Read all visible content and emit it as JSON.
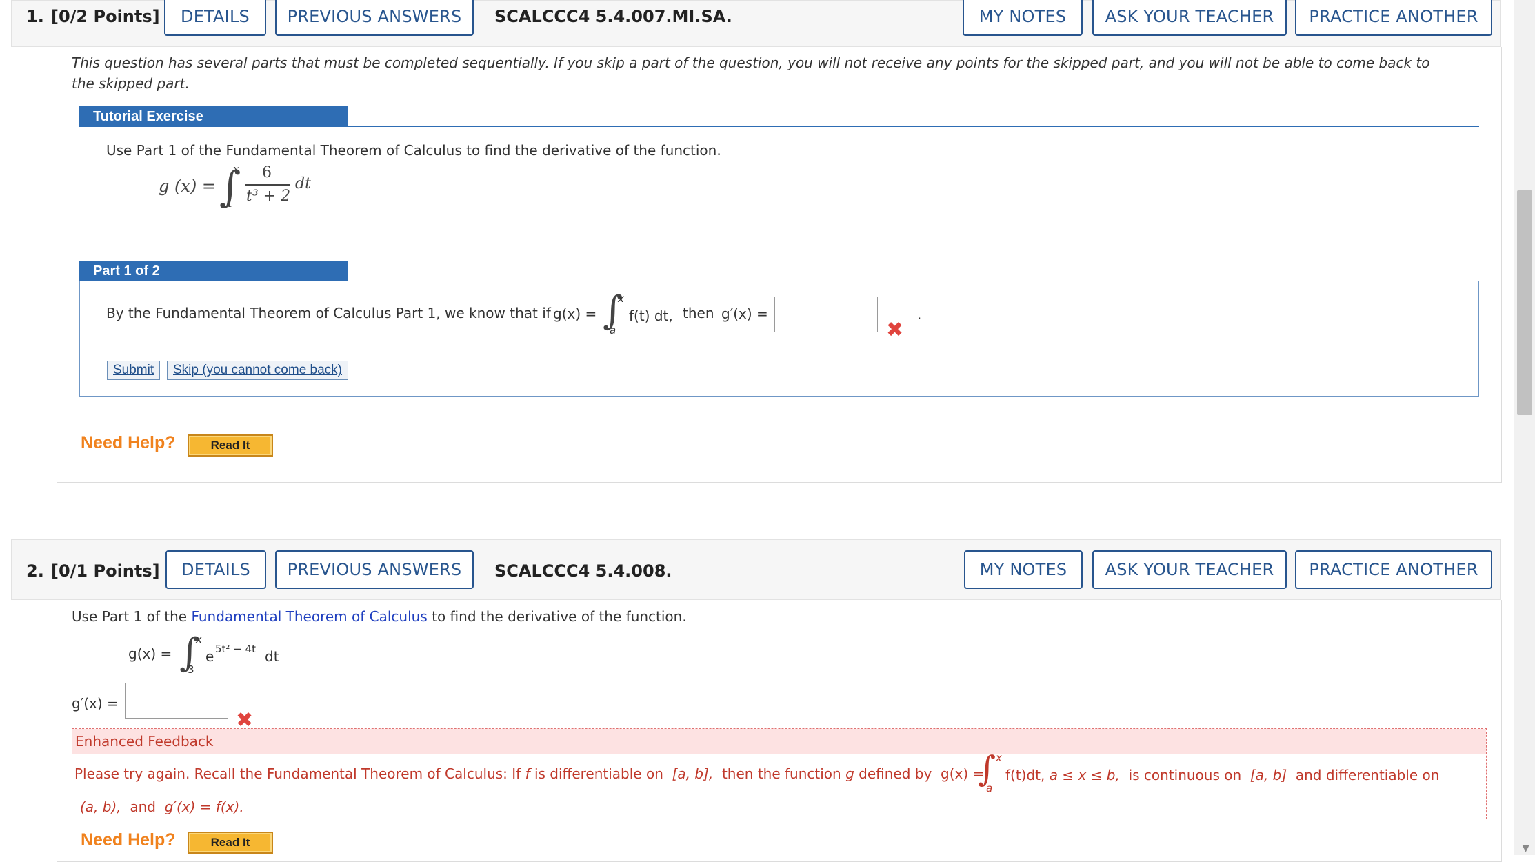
{
  "q1": {
    "number": "1.",
    "points": "[0/2 Points]",
    "buttons": {
      "details": "DETAILS",
      "previous_answers": "PREVIOUS ANSWERS",
      "my_notes": "MY NOTES",
      "ask_teacher": "ASK YOUR TEACHER",
      "practice_another": "PRACTICE ANOTHER"
    },
    "code": "SCALCCC4 5.4.007.MI.SA.",
    "note": "This question has several parts that must be completed sequentially. If you skip a part of the question, you will not receive any points for the skipped part, and you will not be able to come back to the skipped part.",
    "tutorial_label": "Tutorial Exercise",
    "instruction": "Use Part 1 of the Fundamental Theorem of Calculus to find the derivative of the function.",
    "formula": {
      "lhs": "g (x) =",
      "upper": "x",
      "lower": "1",
      "numerator": "6",
      "denominator": "t³ + 2",
      "dt": "dt"
    },
    "part_label": "Part 1 of 2",
    "part_text": "By the Fundamental Theorem of Calculus Part 1, we know that if",
    "part_gx": "g(x) =",
    "part_upper": "x",
    "part_lower": "a",
    "part_integrand": "f(t) dt,",
    "part_then": "then",
    "part_gprime": "g′(x) =",
    "part_answer": "",
    "part_period": ".",
    "submit_label": "Submit",
    "skip_label": "Skip (you cannot come back)",
    "need_help": "Need Help?",
    "read_it": "Read It"
  },
  "q2": {
    "number": "2.",
    "points": "[0/1 Points]",
    "buttons": {
      "details": "DETAILS",
      "previous_answers": "PREVIOUS ANSWERS",
      "my_notes": "MY NOTES",
      "ask_teacher": "ASK YOUR TEACHER",
      "practice_another": "PRACTICE ANOTHER"
    },
    "code": "SCALCCC4 5.4.008.",
    "instruction_pre": "Use Part 1 of the",
    "instruction_link": "Fundamental Theorem of Calculus",
    "instruction_post": "to find the derivative of the function.",
    "formula": {
      "lhs": "g(x) =",
      "upper": "x",
      "lower": "3",
      "base": "e",
      "exponent": "5t² − 4t",
      "dt": "dt"
    },
    "answer_label": "g′(x) =",
    "answer_value": "",
    "feedback_title": "Enhanced Feedback",
    "feedback_line1_pre": "Please try again. Recall the Fundamental Theorem of Calculus: If",
    "feedback_f": "f",
    "feedback_line1_mid": "is differentiable on",
    "feedback_interval1": "[a, b],",
    "feedback_line1_mid2": "then the function",
    "feedback_g": "g",
    "feedback_line1_mid3": "defined by",
    "feedback_gx": "g(x) =",
    "feedback_upper": "x",
    "feedback_lower": "a",
    "feedback_integrand": "f(t)dt,",
    "feedback_condition": "a ≤ x ≤ b,",
    "feedback_line1_mid4": "is continuous on",
    "feedback_interval2": "[a, b]",
    "feedback_line1_end": "and differentiable on",
    "feedback_interval3": "(a, b),",
    "feedback_and": "and",
    "feedback_conclusion": "g′(x) = f(x).",
    "need_help": "Need Help?",
    "read_it": "Read It"
  }
}
